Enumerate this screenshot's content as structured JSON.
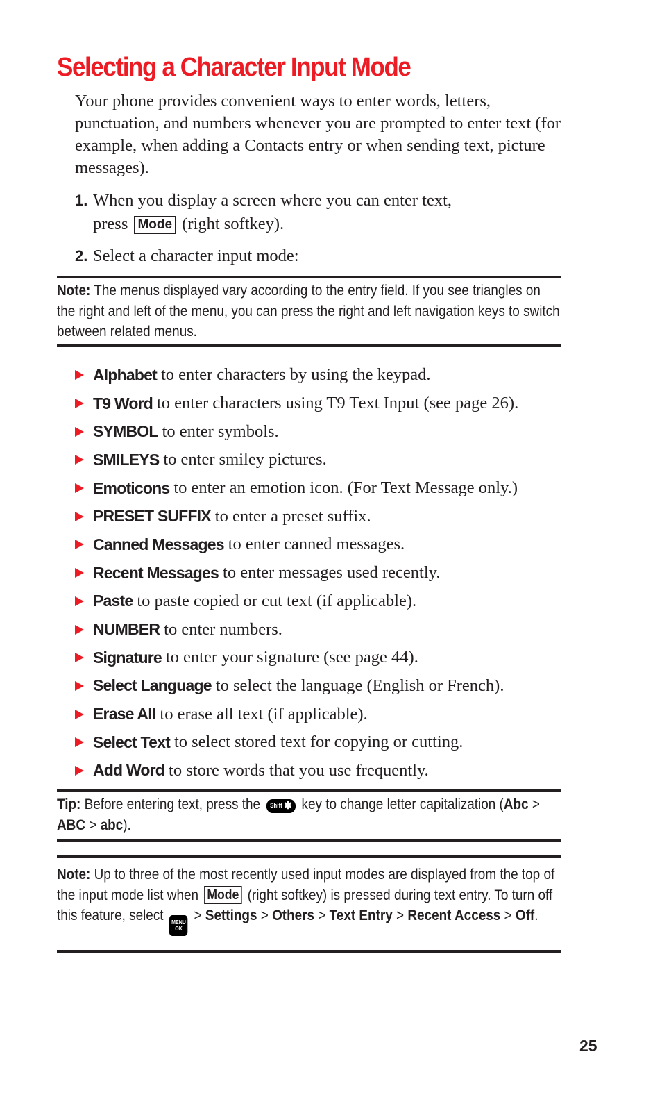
{
  "title": "Selecting a Character Input Mode",
  "intro": "Your phone provides convenient ways to enter words, letters, punctuation, and numbers whenever you are prompted to enter text (for example, when adding a Contacts entry or when sending text, picture messages).",
  "steps": [
    {
      "num": "1.",
      "text_before": "When you display a screen where you can enter text,",
      "text_press": "press",
      "key": "Mode",
      "text_after": "(right softkey)."
    },
    {
      "num": "2.",
      "text": "Select a character input mode:"
    }
  ],
  "note1": {
    "label": "Note:",
    "text": "The menus displayed vary according to the entry field. If you see triangles on the right and left of the menu, you can press the right and left navigation keys to switch between related menus."
  },
  "options": [
    {
      "name": "Alphabet",
      "desc": "to enter characters by using the keypad."
    },
    {
      "name": "T9 Word",
      "desc": "to enter characters using T9 Text Input (see page 26)."
    },
    {
      "name": "SYMBOL",
      "desc": "to enter symbols."
    },
    {
      "name": "SMILEYS",
      "desc": "to enter smiley pictures."
    },
    {
      "name": "Emoticons",
      "desc": "to enter an emotion icon. (For Text Message only.)"
    },
    {
      "name": "PRESET SUFFIX",
      "desc": "to enter a preset suffix."
    },
    {
      "name": "Canned Messages",
      "desc": "to enter canned messages."
    },
    {
      "name": "Recent Messages",
      "desc": "to enter messages used recently."
    },
    {
      "name": "Paste",
      "desc": "to paste copied or cut text (if applicable)."
    },
    {
      "name": "NUMBER",
      "desc": "to enter numbers."
    },
    {
      "name": "Signature",
      "desc": "to enter your signature (see page 44)."
    },
    {
      "name": "Select Language",
      "desc": "to select the language (English or French)."
    },
    {
      "name": "Erase All",
      "desc": "to erase all text (if applicable)."
    },
    {
      "name": "Select Text",
      "desc": "to select stored text for copying or cutting."
    },
    {
      "name": "Add Word",
      "desc": "to store words that you use frequently."
    }
  ],
  "tip": {
    "label": "Tip:",
    "text_before": "Before entering text, press the",
    "key_label": "Shift",
    "key_symbol": "✱",
    "text_after": "key to change letter capitalization (",
    "cap1": "Abc",
    "sep": ">",
    "cap2": "ABC",
    "cap3": "abc",
    "end": ")."
  },
  "note2": {
    "label": "Note:",
    "text1": "Up to three of the most recently used input modes are displayed from the top of the input mode list when",
    "key": "Mode",
    "text2": "(right softkey) is pressed during text entry. To turn off this feature, select",
    "menu_key_top": "MENU",
    "menu_key_bottom": "OK",
    "sep": ">",
    "path": [
      "Settings",
      "Others",
      "Text Entry",
      "Recent Access",
      "Off"
    ],
    "end": "."
  },
  "colors": {
    "accent": "#ed1c24",
    "text": "#231f20"
  },
  "page_number": "25"
}
